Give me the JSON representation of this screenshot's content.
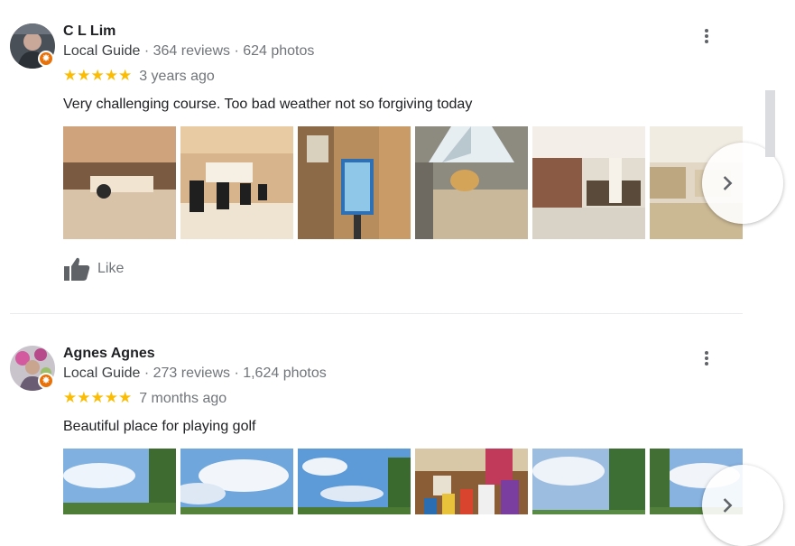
{
  "reviews": [
    {
      "name": "C L Lim",
      "guide_label": "Local Guide",
      "stats": "· 364 reviews · 624 photos",
      "stars": "★★★★★",
      "rating": 5,
      "date": "3 years ago",
      "text": "Very challenging course. Too bad weather not so forgiving today",
      "like_label": "Like"
    },
    {
      "name": "Agnes Agnes",
      "guide_label": "Local Guide",
      "stats": "· 273 reviews · 1,624 photos",
      "stars": "★★★★★",
      "rating": 5,
      "date": "7 months ago",
      "text": "Beautiful place for playing golf"
    }
  ],
  "icons": {
    "more": "more-vert-icon",
    "next": "chevron-right-icon",
    "like": "thumb-up-icon",
    "badge": "local-guide-badge-icon"
  },
  "colors": {
    "star": "#fbbc04",
    "badge": "#e8710a",
    "muted": "#70757a"
  }
}
